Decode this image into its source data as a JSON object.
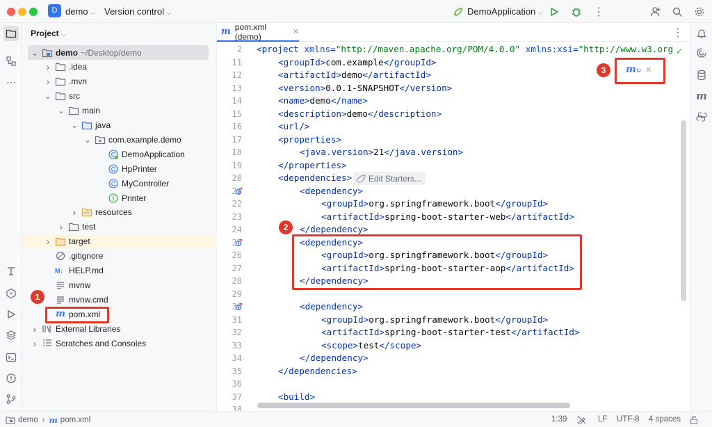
{
  "titlebar": {
    "project_initial": "D",
    "project_name": "demo",
    "vcs_label": "Version control",
    "run_config": "DemoApplication"
  },
  "project_panel": {
    "title": "Project",
    "tree": [
      {
        "label": "demo",
        "sub": "~/Desktop/demo",
        "indent": 0,
        "chev": "down",
        "icon": "module-folder-icon",
        "bold": true,
        "sel": true
      },
      {
        "label": ".idea",
        "indent": 1,
        "chev": "right",
        "icon": "folder-icon"
      },
      {
        "label": ".mvn",
        "indent": 1,
        "chev": "right",
        "icon": "folder-icon"
      },
      {
        "label": "src",
        "indent": 1,
        "chev": "down",
        "icon": "folder-icon"
      },
      {
        "label": "main",
        "indent": 2,
        "chev": "down",
        "icon": "folder-icon"
      },
      {
        "label": "java",
        "indent": 3,
        "chev": "down",
        "icon": "source-folder-icon"
      },
      {
        "label": "com.example.demo",
        "indent": 4,
        "chev": "down",
        "icon": "package-icon"
      },
      {
        "label": "DemoApplication",
        "indent": 5,
        "chev": "",
        "icon": "spring-class-icon"
      },
      {
        "label": "HpPrinter",
        "indent": 5,
        "chev": "",
        "icon": "class-icon"
      },
      {
        "label": "MyController",
        "indent": 5,
        "chev": "",
        "icon": "class-icon"
      },
      {
        "label": "Printer",
        "indent": 5,
        "chev": "",
        "icon": "interface-icon"
      },
      {
        "label": "resources",
        "indent": 3,
        "chev": "right",
        "icon": "resources-folder-icon"
      },
      {
        "label": "test",
        "indent": 2,
        "chev": "right",
        "icon": "folder-icon"
      },
      {
        "label": "target",
        "indent": 1,
        "chev": "right",
        "icon": "excluded-folder-icon",
        "hl": true
      },
      {
        "label": ".gitignore",
        "indent": 1,
        "chev": "",
        "icon": "ignore-file-icon"
      },
      {
        "label": "HELP.md",
        "indent": 1,
        "chev": "",
        "icon": "markdown-icon"
      },
      {
        "label": "mvnw",
        "indent": 1,
        "chev": "",
        "icon": "text-file-icon"
      },
      {
        "label": "mvnw.cmd",
        "indent": 1,
        "chev": "",
        "icon": "text-file-icon"
      },
      {
        "label": "pom.xml",
        "indent": 1,
        "chev": "",
        "icon": "maven-icon"
      },
      {
        "label": "External Libraries",
        "indent": 0,
        "chev": "right",
        "icon": "libraries-icon"
      },
      {
        "label": "Scratches and Consoles",
        "indent": 0,
        "chev": "right",
        "icon": "scratches-icon"
      }
    ]
  },
  "editor": {
    "tab_label": "pom.xml (demo)",
    "edit_starters": "Edit Starters...",
    "lines": [
      {
        "n": "2",
        "i": 0,
        "c": [
          [
            "t",
            "<project "
          ],
          [
            "a",
            "xmlns"
          ],
          [
            "t",
            "="
          ],
          [
            "s",
            "\"http://maven.apache.org/POM/4.0.0\" "
          ],
          [
            "a",
            "xmlns:xsi"
          ],
          [
            "t",
            "="
          ],
          [
            "s",
            "\"http://www.w3.org"
          ]
        ]
      },
      {
        "n": "11",
        "i": 1,
        "c": [
          [
            "t",
            "<groupId>"
          ],
          [
            "p",
            "com.example"
          ],
          [
            "t",
            "</groupId>"
          ]
        ]
      },
      {
        "n": "12",
        "i": 1,
        "c": [
          [
            "t",
            "<artifactId>"
          ],
          [
            "p",
            "demo"
          ],
          [
            "t",
            "</artifactId>"
          ]
        ]
      },
      {
        "n": "13",
        "i": 1,
        "c": [
          [
            "t",
            "<version>"
          ],
          [
            "p",
            "0.0.1-SNAPSHOT"
          ],
          [
            "t",
            "</version>"
          ]
        ]
      },
      {
        "n": "14",
        "i": 1,
        "c": [
          [
            "t",
            "<name>"
          ],
          [
            "p",
            "demo"
          ],
          [
            "t",
            "</name>"
          ]
        ]
      },
      {
        "n": "15",
        "i": 1,
        "c": [
          [
            "t",
            "<description>"
          ],
          [
            "p",
            "demo"
          ],
          [
            "t",
            "</description>"
          ]
        ]
      },
      {
        "n": "16",
        "i": 1,
        "c": [
          [
            "t",
            "<url/>"
          ]
        ]
      },
      {
        "n": "17",
        "i": 1,
        "c": [
          [
            "t",
            "<properties>"
          ]
        ]
      },
      {
        "n": "18",
        "i": 2,
        "c": [
          [
            "t",
            "<java.version>"
          ],
          [
            "p",
            "21"
          ],
          [
            "t",
            "</java.version>"
          ]
        ]
      },
      {
        "n": "19",
        "i": 1,
        "c": [
          [
            "t",
            "</properties>"
          ]
        ]
      },
      {
        "n": "20",
        "i": 1,
        "c": [
          [
            "t",
            "<dependencies>"
          ]
        ]
      },
      {
        "n": "21",
        "i": 2,
        "c": [
          [
            "t",
            "<dependency>"
          ]
        ]
      },
      {
        "n": "22",
        "i": 3,
        "c": [
          [
            "t",
            "<groupId>"
          ],
          [
            "p",
            "org.springframework.boot"
          ],
          [
            "t",
            "</groupId>"
          ]
        ]
      },
      {
        "n": "23",
        "i": 3,
        "c": [
          [
            "t",
            "<artifactId>"
          ],
          [
            "p",
            "spring-boot-starter-web"
          ],
          [
            "t",
            "</artifactId>"
          ]
        ]
      },
      {
        "n": "24",
        "i": 2,
        "c": [
          [
            "t",
            "</dependency>"
          ]
        ]
      },
      {
        "n": "25",
        "i": 2,
        "c": [
          [
            "t",
            "<dependency>"
          ]
        ]
      },
      {
        "n": "26",
        "i": 3,
        "c": [
          [
            "t",
            "<groupId>"
          ],
          [
            "p",
            "org.springframework.boot"
          ],
          [
            "t",
            "</groupId>"
          ]
        ]
      },
      {
        "n": "27",
        "i": 3,
        "c": [
          [
            "t",
            "<artifactId>"
          ],
          [
            "p",
            "spring-boot-starter-aop"
          ],
          [
            "t",
            "</artifactId>"
          ]
        ]
      },
      {
        "n": "28",
        "i": 2,
        "c": [
          [
            "t",
            "</dependency>"
          ]
        ]
      },
      {
        "n": "29",
        "i": 0,
        "c": []
      },
      {
        "n": "30",
        "i": 2,
        "c": [
          [
            "t",
            "<dependency>"
          ]
        ]
      },
      {
        "n": "31",
        "i": 3,
        "c": [
          [
            "t",
            "<groupId>"
          ],
          [
            "p",
            "org.springframework.boot"
          ],
          [
            "t",
            "</groupId>"
          ]
        ]
      },
      {
        "n": "32",
        "i": 3,
        "c": [
          [
            "t",
            "<artifactId>"
          ],
          [
            "p",
            "spring-boot-starter-test"
          ],
          [
            "t",
            "</artifactId>"
          ]
        ]
      },
      {
        "n": "33",
        "i": 3,
        "c": [
          [
            "t",
            "<scope>"
          ],
          [
            "p",
            "test"
          ],
          [
            "t",
            "</scope>"
          ]
        ]
      },
      {
        "n": "34",
        "i": 2,
        "c": [
          [
            "t",
            "</dependency>"
          ]
        ]
      },
      {
        "n": "35",
        "i": 1,
        "c": [
          [
            "t",
            "</dependencies>"
          ]
        ]
      },
      {
        "n": "36",
        "i": 0,
        "c": []
      },
      {
        "n": "37",
        "i": 1,
        "c": [
          [
            "t",
            "<build>"
          ]
        ]
      },
      {
        "n": "38",
        "i": 0,
        "c": []
      }
    ],
    "gutter_marks": [
      "21",
      "25",
      "30"
    ]
  },
  "annotations": {
    "b1": "1",
    "b2": "2",
    "b3": "3"
  },
  "statusbar": {
    "path_root": "demo",
    "path_file": "pom.xml",
    "position": "1:39",
    "line_sep": "LF",
    "encoding": "UTF-8",
    "indent": "4 spaces"
  },
  "colors": {
    "accent": "#3574f0",
    "annotation": "#e0392b",
    "tag": "#0033b3",
    "string": "#067d17"
  }
}
